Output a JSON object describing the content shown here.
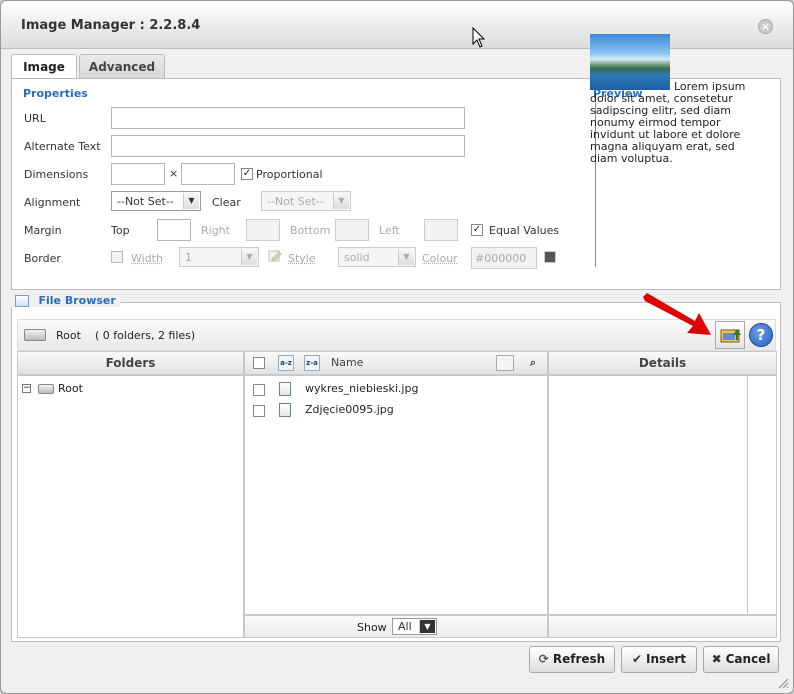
{
  "dialog": {
    "title": "Image Manager : 2.2.8.4",
    "close_glyph": "×"
  },
  "tabs": [
    {
      "label": "Image"
    },
    {
      "label": "Advanced"
    }
  ],
  "properties": {
    "legend": "Properties",
    "url_label": "URL",
    "alt_label": "Alternate Text",
    "dimensions_label": "Dimensions",
    "times": "×",
    "proportional_label": "Proportional",
    "alignment_label": "Alignment",
    "alignment_value": "--Not Set--",
    "clear_label": "Clear",
    "clear_value": "--Not Set--",
    "margin_label": "Margin",
    "top_label": "Top",
    "right_label": "Right",
    "bottom_label": "Bottom",
    "left_label": "Left",
    "equal_values_label": "Equal Values",
    "border_label": "Border",
    "width_label": "Width",
    "width_value": "1",
    "style_label": "Style",
    "style_value": "solid",
    "colour_label": "Colour",
    "colour_value": "#000000"
  },
  "preview": {
    "legend": "Preview",
    "text": "Lorem ipsum dolor sit amet, consetetur sadipscing elitr, sed diam nonumy eirmod tempor invidunt ut labore et dolore magna aliquyam erat, sed diam voluptua."
  },
  "file_browser": {
    "legend": "File Browser",
    "root_label": "Root",
    "summary": "( 0 folders, 2 files)",
    "folders_header": "Folders",
    "name_header": "Name",
    "details_header": "Details",
    "tree_root": "Root",
    "files": [
      {
        "name": "wykres_niebieski.jpg"
      },
      {
        "name": "Zdjęcie0095.jpg"
      }
    ],
    "show_label": "Show",
    "show_value": "All"
  },
  "buttons": {
    "refresh": "Refresh",
    "insert": "Insert",
    "cancel": "Cancel"
  },
  "colors": {
    "accent": "#2a6ebb",
    "arrow": "#e00000",
    "help": "#2a5fbf"
  }
}
